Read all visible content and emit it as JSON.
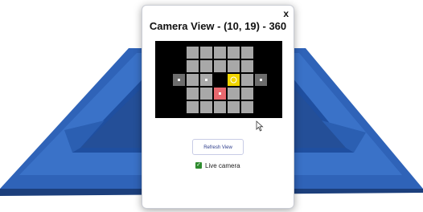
{
  "popup": {
    "title": "Camera View - (10, 19) - 360",
    "close_label": "x",
    "refresh_label": "Refresh View",
    "live_camera_label": "Live camera",
    "live_camera_checked": true
  },
  "camera_grid": {
    "rows": 5,
    "cols": 5,
    "agent_color": "#e8686e",
    "target_color": "#f1d600",
    "floor_color": "#a8a8a8",
    "void_color": "#000000"
  },
  "colors": {
    "arena_wall": "#2f63b8",
    "arena_wall_dark": "#1e4b94"
  }
}
